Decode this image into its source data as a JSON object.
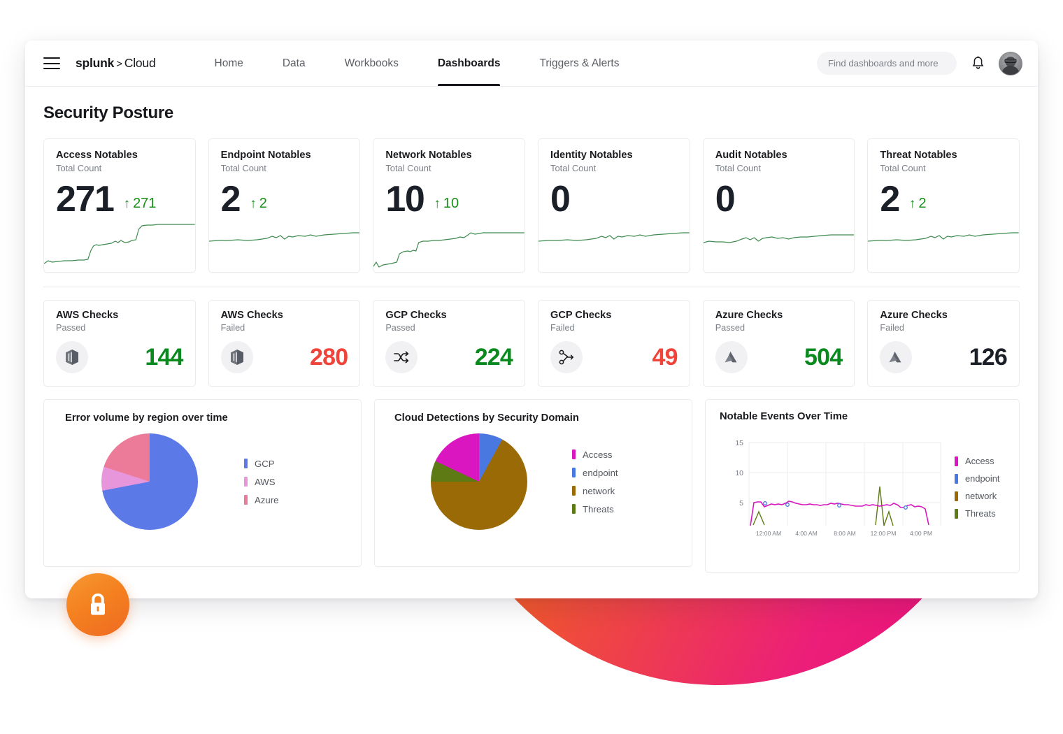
{
  "brand": {
    "logo_word": "splunk",
    "logo_sep": ">",
    "logo_product": "Cloud"
  },
  "nav": {
    "items": [
      {
        "label": "Home",
        "active": false
      },
      {
        "label": "Data",
        "active": false
      },
      {
        "label": "Workbooks",
        "active": false
      },
      {
        "label": "Dashboards",
        "active": true
      },
      {
        "label": "Triggers & Alerts",
        "active": false
      }
    ],
    "search_placeholder": "Find dashboards and more",
    "search_value": ""
  },
  "page": {
    "title": "Security Posture"
  },
  "kpis": [
    {
      "title": "Access Notables",
      "subtitle": "Total Count",
      "value": "271",
      "delta": "271",
      "delta_dir": "up",
      "delta_color": "#189017",
      "spark": "step-up-high"
    },
    {
      "title": "Endpoint Notables",
      "subtitle": "Total Count",
      "value": "2",
      "delta": "2",
      "delta_dir": "up",
      "delta_color": "#189017",
      "spark": "flat"
    },
    {
      "title": "Network Notables",
      "subtitle": "Total Count",
      "value": "10",
      "delta": "10",
      "delta_dir": "up",
      "delta_color": "#189017",
      "spark": "step-up-mid"
    },
    {
      "title": "Identity Notables",
      "subtitle": "Total Count",
      "value": "0",
      "delta": "",
      "delta_dir": "",
      "delta_color": "#189017",
      "spark": "flat"
    },
    {
      "title": "Audit Notables",
      "subtitle": "Total Count",
      "value": "0",
      "delta": "",
      "delta_dir": "",
      "delta_color": "#189017",
      "spark": "flat-noisy"
    },
    {
      "title": "Threat Notables",
      "subtitle": "Total Count",
      "value": "2",
      "delta": "2",
      "delta_dir": "up",
      "delta_color": "#189017",
      "spark": "flat"
    }
  ],
  "checks": [
    {
      "title": "AWS Checks",
      "subtitle": "Passed",
      "value": "144",
      "value_color": "#0a8a1e",
      "icon": "aws-cube-icon"
    },
    {
      "title": "AWS Checks",
      "subtitle": "Failed",
      "value": "280",
      "value_color": "#F0443A",
      "icon": "aws-cube-icon"
    },
    {
      "title": "GCP Checks",
      "subtitle": "Passed",
      "value": "224",
      "value_color": "#0a8a1e",
      "icon": "shuffle-arrows-icon"
    },
    {
      "title": "GCP Checks",
      "subtitle": "Failed",
      "value": "49",
      "value_color": "#F0443A",
      "icon": "node-branch-icon"
    },
    {
      "title": "Azure Checks",
      "subtitle": "Passed",
      "value": "504",
      "value_color": "#0a8a1e",
      "icon": "azure-triangle-icon"
    },
    {
      "title": "Azure Checks",
      "subtitle": "Failed",
      "value": "126",
      "value_color": "#1b1f27",
      "icon": "azure-triangle-icon"
    }
  ],
  "panels": {
    "pie_region": {
      "title": "Error volume by region over time"
    },
    "pie_domain": {
      "title": "Cloud Detections by Security Domain"
    },
    "line_events": {
      "title": "Notable Events Over Time"
    }
  },
  "chart_data": [
    {
      "type": "pie",
      "title": "Error volume by region over time",
      "labels": [
        "GCP",
        "AWS",
        "Azure"
      ],
      "values": [
        72,
        8,
        20
      ],
      "colors": [
        "#5B7AE8",
        "#E896DC",
        "#EB7B98"
      ],
      "legend_position": "right"
    },
    {
      "type": "pie",
      "title": "Cloud Detections by Security Domain",
      "labels": [
        "Access",
        "endpoint",
        "network",
        "Threats"
      ],
      "values": [
        18,
        8,
        67,
        7
      ],
      "colors": [
        "#D916C0",
        "#4979E0",
        "#9A6A06",
        "#5E7A14"
      ],
      "legend_position": "right"
    },
    {
      "type": "line",
      "title": "Notable Events Over Time",
      "xlabel": "",
      "ylabel": "",
      "ylim": [
        0,
        15
      ],
      "yticks": [
        5,
        10,
        15
      ],
      "xticks": [
        "12:00 AM",
        "4:00 AM",
        "8:00 AM",
        "12:00 PM",
        "4:00 PM"
      ],
      "grid": true,
      "legend_position": "right",
      "series": [
        {
          "name": "Access",
          "color": "#D916C0",
          "values": [
            1.2,
            4.8,
            4.7,
            4.0,
            4.5,
            4.3,
            4.4,
            4.4,
            4.8,
            4.6,
            4.4,
            4.3,
            4.3,
            4.4,
            4.3,
            4.2,
            4.2,
            4.5,
            4.3,
            4.4,
            4.3,
            4.1,
            4.0,
            4.0,
            4.3,
            4.2,
            4.3,
            4.5,
            3.9,
            4.0,
            4.2,
            4.1,
            3.9,
            1.0
          ]
        },
        {
          "name": "endpoint",
          "color": "#4979E0",
          "values": [
            null,
            null,
            4.5,
            null,
            null,
            4.3,
            null,
            null,
            null,
            null,
            null,
            4.2,
            null,
            null,
            null,
            null,
            null,
            null,
            null,
            null,
            null,
            null,
            null,
            null,
            null,
            null,
            null,
            null,
            4.0,
            null,
            null,
            null,
            null,
            null
          ]
        },
        {
          "name": "network",
          "color": "#9A6A06",
          "values": []
        },
        {
          "name": "Threats",
          "color": "#5E7A14",
          "values": [
            null,
            0.6,
            2.3,
            0.7,
            null,
            null,
            null,
            null,
            null,
            null,
            null,
            null,
            null,
            null,
            null,
            null,
            null,
            null,
            null,
            null,
            0.7,
            6.5,
            0.6,
            2.2,
            0.6,
            null,
            null,
            null,
            null,
            null,
            null,
            null,
            null,
            null
          ]
        }
      ]
    }
  ],
  "badge": {
    "icon": "lock-icon"
  }
}
